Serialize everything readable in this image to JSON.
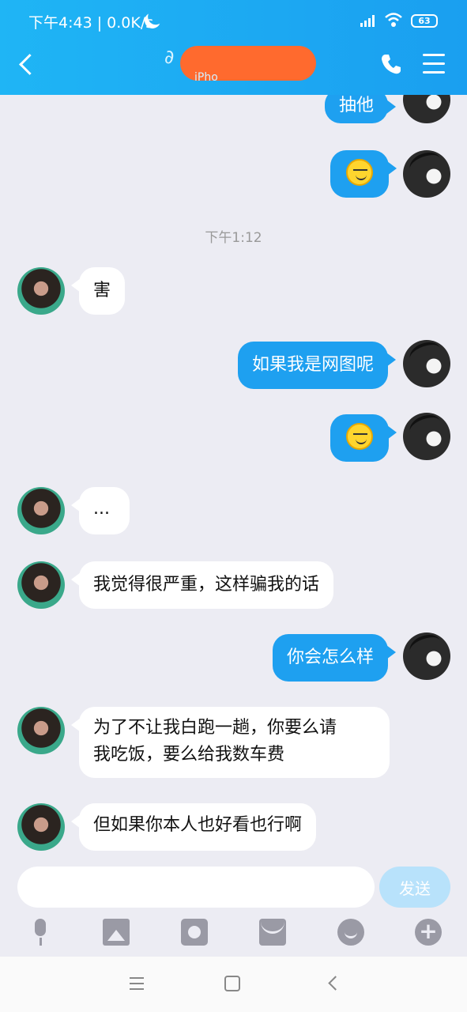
{
  "status_bar": {
    "time_speed": "下午4:43 | 0.0K/s",
    "battery": "63"
  },
  "header": {
    "subtitle": "iPho"
  },
  "chat": {
    "time_label": "下午1:12",
    "messages": [
      {
        "side": "out",
        "text": "抽他"
      },
      {
        "side": "out",
        "emoji": "smirk-emoji"
      },
      {
        "side": "in",
        "text": "害"
      },
      {
        "side": "out",
        "text": "如果我是网图呢"
      },
      {
        "side": "out",
        "emoji": "smirk-emoji"
      },
      {
        "side": "in",
        "text": "..."
      },
      {
        "side": "in",
        "text": "我觉得很严重，这样骗我的话"
      },
      {
        "side": "out",
        "text": "你会怎么样"
      },
      {
        "side": "in",
        "text_line1": "为了不让我白跑一趟，你要么请",
        "text_line2": "我吃饭，要么给我数车费"
      },
      {
        "side": "in",
        "text": "但如果你本人也好看也行啊"
      }
    ]
  },
  "input": {
    "value": "",
    "send_label": "发送"
  },
  "toolbar": [
    "mic-icon",
    "image-icon",
    "camera-icon",
    "red-packet-icon",
    "emoji-icon",
    "plus-icon"
  ],
  "colors": {
    "header": "#1fb5f5",
    "bubble_out": "#1ea0f0",
    "bubble_in": "#ffffff",
    "background": "#ececf3",
    "redaction": "#ff6a2e"
  }
}
